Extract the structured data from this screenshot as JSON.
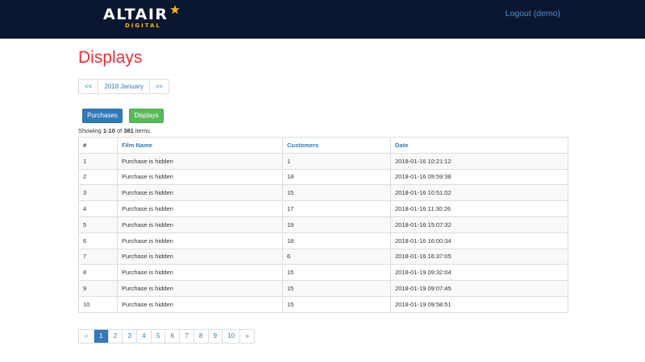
{
  "header": {
    "logo_main": "ALTAIR",
    "logo_sub": "DIGITAL",
    "logout_label": "Logout (demo)",
    "colors": {
      "bar": "#0b1730",
      "accent": "#f2b51d",
      "link": "#4a90d9"
    }
  },
  "page": {
    "title": "Displays",
    "title_color": "#e8303a"
  },
  "month_pager": {
    "prev_label": "<<",
    "current_label": "2018 January",
    "next_label": ">>"
  },
  "buttons": {
    "purchases_label": "Purchases",
    "displays_label": "Displays"
  },
  "summary": {
    "prefix": "Showing ",
    "range": "1-10",
    "middle": " of ",
    "total": "381",
    "suffix": " items."
  },
  "table": {
    "columns": [
      "#",
      "Film Name",
      "Customers",
      "Date"
    ],
    "rows": [
      [
        "1",
        "Purchase is hidden",
        "1",
        "2018-01-16 10:21:12"
      ],
      [
        "2",
        "Purchase is hidden",
        "18",
        "2018-01-16 09:59:38"
      ],
      [
        "3",
        "Purchase is hidden",
        "15",
        "2018-01-16 10:51:02"
      ],
      [
        "4",
        "Purchase is hidden",
        "17",
        "2018-01-16 11:30:26"
      ],
      [
        "5",
        "Purchase is hidden",
        "19",
        "2018-01-16 15:07:32"
      ],
      [
        "6",
        "Purchase is hidden",
        "18",
        "2018-01-16 16:00:34"
      ],
      [
        "7",
        "Purchase is hidden",
        "6",
        "2018-01-16 16:37:05"
      ],
      [
        "8",
        "Purchase is hidden",
        "15",
        "2018-01-19 09:32:04"
      ],
      [
        "9",
        "Purchase is hidden",
        "15",
        "2018-01-19 09:07:45"
      ],
      [
        "10",
        "Purchase is hidden",
        "15",
        "2018-01-19 09:58:51"
      ]
    ]
  },
  "pagination": {
    "prev_label": "«",
    "pages": [
      "1",
      "2",
      "3",
      "4",
      "5",
      "6",
      "7",
      "8",
      "9",
      "10"
    ],
    "active_page": "1",
    "next_label": "»"
  }
}
